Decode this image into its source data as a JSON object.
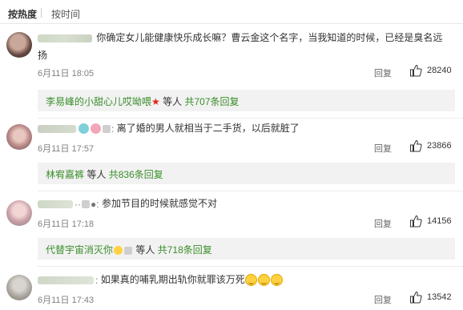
{
  "sort": {
    "hot": "按热度",
    "time": "按时间"
  },
  "comments": [
    {
      "text": "你确定女儿能健康快乐成长嘛？曹云金这个名字，当我知道的时候，已经是臭名远",
      "text2": "扬",
      "date": "6月11日 18:05",
      "reply": "回复",
      "likes": "28240",
      "sub": {
        "user": "李易峰的小甜心儿哎呦喂",
        "etc": "等人",
        "total": "共707条回复"
      }
    },
    {
      "text": "离了婚的男人就相当于二手货，以后就脏了",
      "date": "6月11日 17:57",
      "reply": "回复",
      "likes": "23866",
      "sub": {
        "user": "林宥嘉裤",
        "etc": "等人",
        "total": "共836条回复"
      }
    },
    {
      "text": "参加节目的时候就感觉不对",
      "date": "6月11日 17:18",
      "reply": "回复",
      "likes": "14156",
      "sub": {
        "user": "代替宇宙消灭你",
        "etc": "等人",
        "total": "共718条回复"
      }
    },
    {
      "text": "如果真的哺乳期出轨你就罪该万死",
      "date": "6月11日 17:43",
      "reply": "回复",
      "likes": "13542"
    }
  ],
  "icons": {
    "like": "thumbs-up-icon",
    "star": "star-icon",
    "emoji": "grin-emoji-icon"
  },
  "colors": {
    "link_green": "#3a8e2a",
    "star_red": "#e2231a",
    "reply_box_bg": "#f2f2f2"
  }
}
